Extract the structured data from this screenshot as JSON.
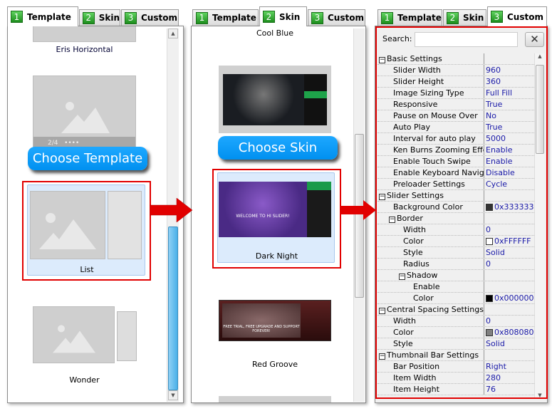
{
  "tabs": [
    {
      "num": "1",
      "label": "Template"
    },
    {
      "num": "2",
      "label": "Skin"
    },
    {
      "num": "3",
      "label": "Custom"
    }
  ],
  "template_panel": {
    "items": [
      "Eris Horizontal",
      "List",
      "Wonder"
    ],
    "control_bar": {
      "page": "2/4"
    },
    "choose_button": "Choose Template",
    "selected": "List"
  },
  "skin_panel": {
    "items": [
      "Cool Blue",
      "Dark Night",
      "Red Groove"
    ],
    "choose_button": "Choose Skin",
    "selected": "Dark Night",
    "dark_night_caption": "WELCOME TO HI SLIDER!",
    "red_groove_caption": "FREE TRIAL, FREE UPGRADE AND SUPPORT FOREVER!"
  },
  "custom_panel": {
    "search_label": "Search:",
    "search_value": "",
    "clear_icon": "close-icon",
    "rows": [
      {
        "name": "Basic Settings",
        "level": 0,
        "group": true
      },
      {
        "name": "Slider Width",
        "level": 1,
        "value": "960"
      },
      {
        "name": "Slider Height",
        "level": 1,
        "value": "360"
      },
      {
        "name": "Image Sizing Type",
        "level": 1,
        "value": "Full Fill"
      },
      {
        "name": "Responsive",
        "level": 1,
        "value": "True"
      },
      {
        "name": "Pause on Mouse Over",
        "level": 1,
        "value": "No"
      },
      {
        "name": "Auto Play",
        "level": 1,
        "value": "True"
      },
      {
        "name": "Interval for auto play",
        "level": 1,
        "value": "5000"
      },
      {
        "name": "Ken Burns Zooming Effect",
        "level": 1,
        "value": "Enable"
      },
      {
        "name": "Enable Touch Swipe",
        "level": 1,
        "value": "Enable"
      },
      {
        "name": "Enable Keyboard Navig...",
        "level": 1,
        "value": "Disable"
      },
      {
        "name": "Preloader Settings",
        "level": 1,
        "value": "Cycle"
      },
      {
        "name": "Slider Settings",
        "level": 0,
        "group": true
      },
      {
        "name": "Background Color",
        "level": 1,
        "value": "0x333333",
        "swatch": "#333333"
      },
      {
        "name": "Border",
        "level": 1,
        "group": true
      },
      {
        "name": "Width",
        "level": 2,
        "value": "0"
      },
      {
        "name": "Color",
        "level": 2,
        "value": "0xFFFFFF",
        "swatch": "#FFFFFF"
      },
      {
        "name": "Style",
        "level": 2,
        "value": "Solid"
      },
      {
        "name": "Radius",
        "level": 2,
        "value": "0"
      },
      {
        "name": "Shadow",
        "level": 2,
        "group": true
      },
      {
        "name": "Enable",
        "level": 3,
        "value": ""
      },
      {
        "name": "Color",
        "level": 3,
        "value": "0x000000",
        "swatch": "#000000"
      },
      {
        "name": "Central Spacing Settings",
        "level": 0,
        "group": true
      },
      {
        "name": "Width",
        "level": 1,
        "value": "0"
      },
      {
        "name": "Color",
        "level": 1,
        "value": "0x808080",
        "swatch": "#808080"
      },
      {
        "name": "Style",
        "level": 1,
        "value": "Solid"
      },
      {
        "name": "Thumbnail Bar Settings",
        "level": 0,
        "group": true
      },
      {
        "name": "Bar Position",
        "level": 1,
        "value": "Right"
      },
      {
        "name": "Item Width",
        "level": 1,
        "value": "280"
      },
      {
        "name": "Item Height",
        "level": 1,
        "value": "76"
      }
    ]
  },
  "colors": {
    "highlight": "#e10000",
    "button": "#0096f5",
    "tab_number": "#2aa52a"
  }
}
